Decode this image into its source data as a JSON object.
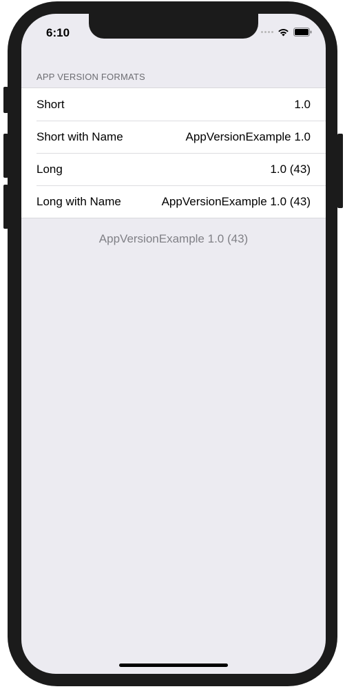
{
  "status_bar": {
    "time": "6:10"
  },
  "section": {
    "header": "APP VERSION FORMATS",
    "rows": [
      {
        "label": "Short",
        "value": "1.0"
      },
      {
        "label": "Short with Name",
        "value": "AppVersionExample 1.0"
      },
      {
        "label": "Long",
        "value": "1.0 (43)"
      },
      {
        "label": "Long with Name",
        "value": "AppVersionExample 1.0 (43)"
      }
    ],
    "footer": "AppVersionExample 1.0 (43)"
  },
  "colors": {
    "background": "#ecebf1",
    "cell": "#ffffff",
    "header_text": "#6d6d72",
    "footer_text": "#808086",
    "bezel": "#1b1b1b"
  }
}
